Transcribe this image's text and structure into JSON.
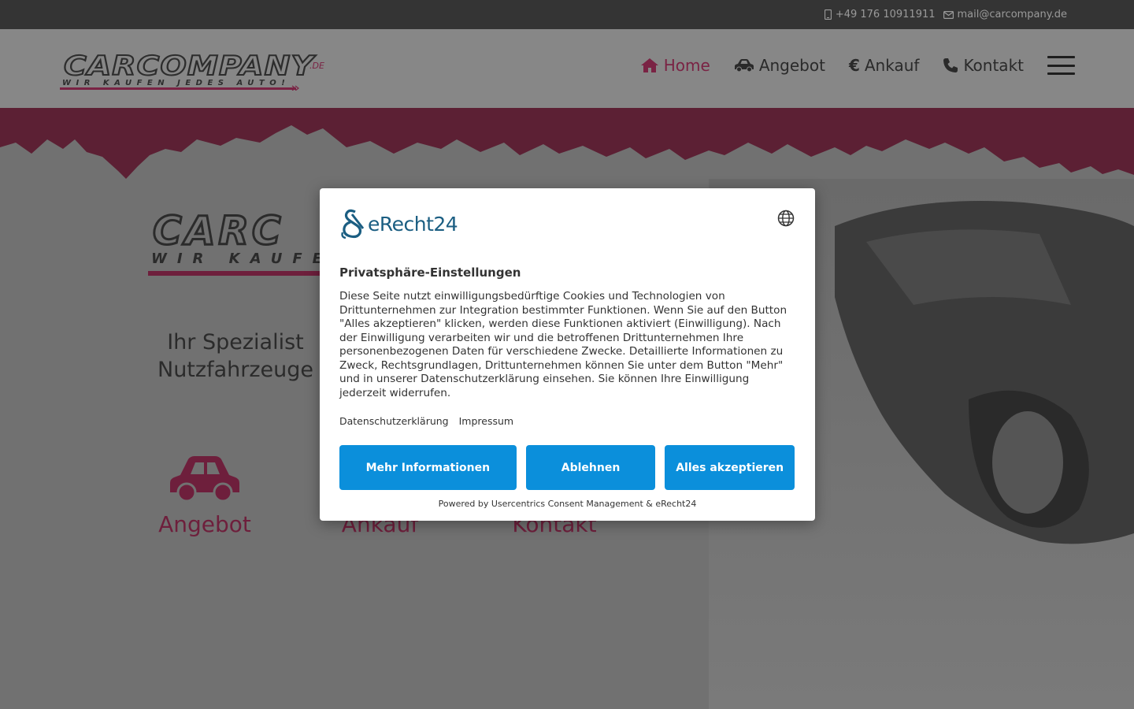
{
  "topbar": {
    "phone": "+49 176 10911911",
    "email": "mail@carcompany.de"
  },
  "logo": {
    "name": "CARCOMPANY",
    "suffix": ".DE",
    "slogan": "WIR KAUFEN JEDES AUTO!"
  },
  "nav": {
    "items": [
      {
        "label": "Home",
        "icon": "home-icon",
        "active": true
      },
      {
        "label": "Angebot",
        "icon": "car-icon",
        "active": false
      },
      {
        "label": "Ankauf",
        "icon": "euro-icon",
        "active": false
      },
      {
        "label": "Kontakt",
        "icon": "phone-icon",
        "active": false
      }
    ],
    "menu_icon": "hamburger-icon"
  },
  "hero": {
    "logo_name": "CARC",
    "logo_slogan": "WIR KAUFE",
    "tagline_line1": "Ihr Spezialist",
    "tagline_line2": "Nutzfahrzeuge",
    "features": [
      {
        "label": "Angebot",
        "icon": "car-icon"
      },
      {
        "label": "Ankauf",
        "icon": "euro-icon"
      },
      {
        "label": "Kontakt",
        "icon": "phone-icon"
      }
    ]
  },
  "consent": {
    "brand": "eRecht24",
    "language_icon": "globe-icon",
    "title": "Privatsphäre-Einstellungen",
    "text": "Diese Seite nutzt einwilligungsbedürftige Cookies und Technologien von Drittunternehmen zur Integration bestimmter Funktionen. Wenn Sie auf den Button \"Alles akzeptieren\" klicken, werden diese Funktionen aktiviert (Einwilligung). Nach der Einwilligung verarbeiten wir und die betroffenen Drittunternehmen Ihre personenbezogenen Daten für verschiedene Zwecke. Detaillierte Informationen zu Zweck, Rechtsgrundlagen, Drittunternehmen können Sie unter dem Button \"Mehr\" und in unserer Datenschutzerklärung einsehen. Sie können Ihre Einwilligung jederzeit widerrufen.",
    "links": [
      "Datenschutzerklärung",
      "Impressum"
    ],
    "buttons": {
      "more": "Mehr Informationen",
      "deny": "Ablehnen",
      "accept": "Alles akzeptieren"
    },
    "powered_by": "Powered by Usercentrics Consent Management & eRecht24"
  },
  "colors": {
    "brand": "#c5386f",
    "button": "#0b8fdb",
    "topbar": "#343434"
  }
}
